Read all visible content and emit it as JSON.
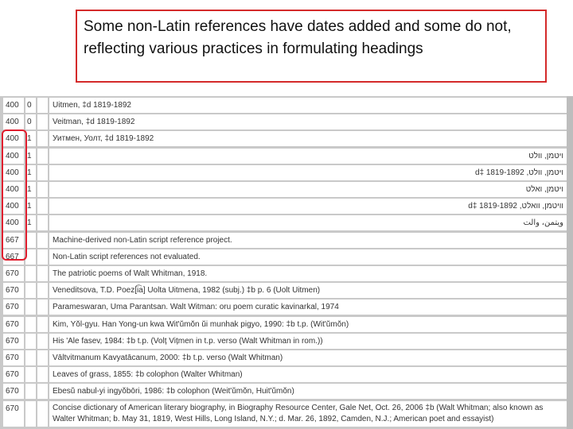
{
  "callout": {
    "text": "Some non-Latin references have dates added and some do not, reflecting various practices in formulating headings"
  },
  "rows": [
    {
      "tag": "400",
      "ind1": "0",
      "ind2": "",
      "value": "Uitmen, ‡d 1819-1892",
      "rtl": false
    },
    {
      "tag": "400",
      "ind1": "0",
      "ind2": "",
      "value": "Veitman, ‡d 1819-1892",
      "rtl": false
    },
    {
      "tag": "400",
      "ind1": "1",
      "ind2": "",
      "value": "Уитмен, Уолт, ‡d 1819-1892",
      "rtl": false
    },
    {
      "tag": "400",
      "ind1": "1",
      "ind2": "",
      "value": "ויטמן, וולט",
      "rtl": true
    },
    {
      "tag": "400",
      "ind1": "1",
      "ind2": "",
      "value": "ויטמן, וולט, 1819-1892 ‡d",
      "rtl": true
    },
    {
      "tag": "400",
      "ind1": "1",
      "ind2": "",
      "value": "ויטמן, ואלט",
      "rtl": true
    },
    {
      "tag": "400",
      "ind1": "1",
      "ind2": "",
      "value": "וויטמן, וואלט, 1819-1892 ‡d",
      "rtl": true
    },
    {
      "tag": "400",
      "ind1": "1",
      "ind2": "",
      "value": "ويتمن، والت",
      "rtl": true
    },
    {
      "tag": "667",
      "ind1": "",
      "ind2": "",
      "value": "Machine-derived non-Latin script reference project.",
      "rtl": false
    },
    {
      "tag": "667",
      "ind1": "",
      "ind2": "",
      "value": "Non-Latin script references not evaluated.",
      "rtl": false
    },
    {
      "tag": "670",
      "ind1": "",
      "ind2": "",
      "value": "The patriotic poems of Walt Whitman, 1918.",
      "rtl": false
    },
    {
      "tag": "670",
      "ind1": "",
      "ind2": "",
      "value": "Veneditsova, T.D. Poez[i͡a] Uolta Uitmena, 1982 (subj.) ‡b p. 6 (Uolt Uitmen)",
      "rtl": false
    },
    {
      "tag": "670",
      "ind1": "",
      "ind2": "",
      "value": "Parameswaran, Uma Parantsan. Walt Witman: oru poem curatic kavinarkal, 1974",
      "rtl": false
    },
    {
      "tag": "670",
      "ind1": "",
      "ind2": "",
      "value": "Kim, Yŏl-gyu. Han Yong-un kwa Wit'ŭmŏn ŭi munhak pigyo, 1990: ‡b t.p. (Wit'ŭmŏn)",
      "rtl": false
    },
    {
      "tag": "670",
      "ind1": "",
      "ind2": "",
      "value": "His 'Ale fasev, 1984: ‡b t.p. (Volț Vițmen in t.p. verso (Walt Whitman in rom.))",
      "rtl": false
    },
    {
      "tag": "670",
      "ind1": "",
      "ind2": "",
      "value": "Vāltvitmanum Kavyatācanum, 2000: ‡b t.p. verso (Walt Whitman)",
      "rtl": false
    },
    {
      "tag": "670",
      "ind1": "",
      "ind2": "",
      "value": "Leaves of grass, 1855: ‡b colophon (Walter Whitman)",
      "rtl": false
    },
    {
      "tag": "670",
      "ind1": "",
      "ind2": "",
      "value": "Ebesŭ nabul-yi ingyŏbōri, 1986: ‡b colophon (Weit'ŭmŏn, Huit'ŭmŏn)",
      "rtl": false
    },
    {
      "tag": "670",
      "ind1": "",
      "ind2": "",
      "value": "Concise dictionary of American literary biography, in Biography Resource Center, Gale Net, Oct. 26, 2006 ‡b (Walt Whitman; also known as Walter Whitman; b. May 31, 1819, West Hills, Long Island, N.Y.; d. Mar. 26, 1892, Camden, N.J.; American poet and essayist)",
      "rtl": false,
      "double": true
    }
  ]
}
